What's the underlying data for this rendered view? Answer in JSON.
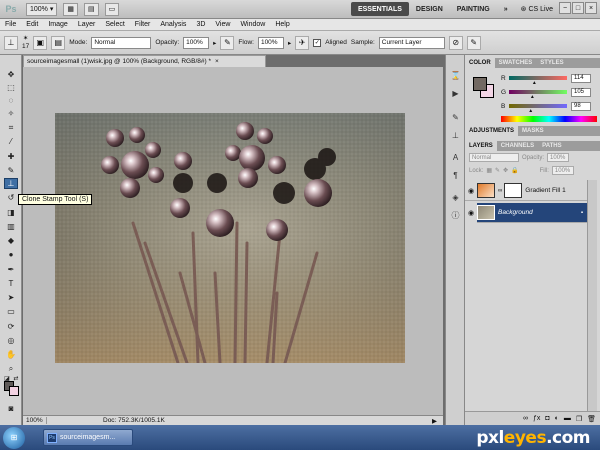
{
  "app": {
    "logo": "Ps",
    "zoom_select": "100%",
    "workspaces": [
      "ESSENTIALS",
      "DESIGN",
      "PAINTING"
    ],
    "active_workspace": "ESSENTIALS",
    "more": "»",
    "cs_live": "CS Live",
    "window_controls": [
      "−",
      "□",
      "×"
    ]
  },
  "menu": [
    "File",
    "Edit",
    "Image",
    "Layer",
    "Select",
    "Filter",
    "Analysis",
    "3D",
    "View",
    "Window",
    "Help"
  ],
  "options": {
    "brush_size": "17",
    "mode_label": "Mode:",
    "mode_value": "Normal",
    "opacity_label": "Opacity:",
    "opacity_value": "100%",
    "flow_label": "Flow:",
    "flow_value": "100%",
    "aligned_label": "Aligned",
    "aligned_checked": "✓",
    "sample_label": "Sample:",
    "sample_value": "Current Layer"
  },
  "document": {
    "tab_title": "sourceimagesmall (1)wisk.jpg @ 100% (Background, RGB/8#) *",
    "close": "×",
    "zoom": "100%",
    "doc_size": "Doc: 752.3K/1005.1K",
    "nav_arrow": "▶"
  },
  "tooltip": "Clone Stamp Tool (S)",
  "panels": {
    "color_tabs": [
      "COLOR",
      "SWATCHES",
      "STYLES"
    ],
    "color": {
      "r_label": "R",
      "r_value": "114",
      "g_label": "G",
      "g_value": "105",
      "b_label": "B",
      "b_value": "98",
      "r_fraction": 0.447,
      "g_fraction": 0.412,
      "b_fraction": 0.384,
      "fg_hex": "#726962",
      "bg_hex": "#f3d6e6"
    },
    "adjust_tabs": [
      "ADJUSTMENTS",
      "MASKS"
    ],
    "layer_tabs": [
      "LAYERS",
      "CHANNELS",
      "PATHS"
    ],
    "blend_mode": "Normal",
    "opacity_label": "Opacity:",
    "opacity_value": "100%",
    "lock_label": "Lock:",
    "fill_label": "Fill:",
    "fill_value": "100%",
    "layers": [
      {
        "name": "Gradient Fill 1",
        "selected": false
      },
      {
        "name": "Background",
        "selected": true
      }
    ],
    "footer_icons": [
      "link-icon",
      "fx-icon",
      "mask-icon",
      "adjustment-icon",
      "folder-icon",
      "new-layer-icon",
      "trash-icon"
    ]
  },
  "taskbar": {
    "start": "⊞",
    "item_icon": "Ps",
    "item_label": "sourceimagesm...",
    "watermark_a": "pxl",
    "watermark_b": "eyes",
    "watermark_c": ".com"
  }
}
